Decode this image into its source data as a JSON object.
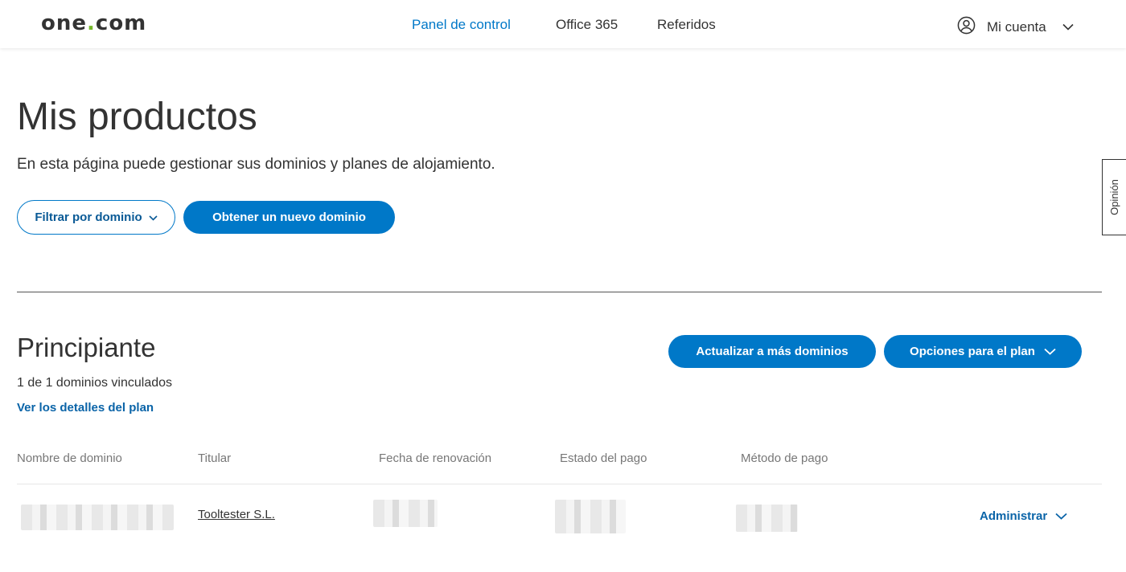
{
  "header": {
    "logo_left": "one",
    "logo_dot": ".",
    "logo_right": "com",
    "nav": [
      {
        "label": "Panel de control",
        "active": true
      },
      {
        "label": "Office 365",
        "active": false
      },
      {
        "label": "Referidos",
        "active": false
      }
    ],
    "account_label": "Mi cuenta",
    "account_icon": "user-circle-icon"
  },
  "page": {
    "title": "Mis productos",
    "subtitle": "En esta página puede gestionar sus dominios y planes de alojamiento.",
    "filter_button": "Filtrar por dominio",
    "new_domain_button": "Obtener un nuevo dominio"
  },
  "plan": {
    "name": "Principiante",
    "linked_count": "1 de 1 dominios vinculados",
    "details_link": "Ver los detalles del plan",
    "upgrade_button": "Actualizar a más dominios",
    "options_button": "Opciones para el plan"
  },
  "table": {
    "columns": [
      "Nombre de dominio",
      "Titular",
      "Fecha de renovación",
      "Estado del pago",
      "Método de pago"
    ],
    "rows": [
      {
        "holder": "Tooltester S.L.",
        "manage_label": "Administrar"
      }
    ]
  },
  "feedback_tab": "Opinión",
  "colors": {
    "accent": "#0078c8",
    "logo_dot": "#76b82a",
    "text": "#333333"
  }
}
